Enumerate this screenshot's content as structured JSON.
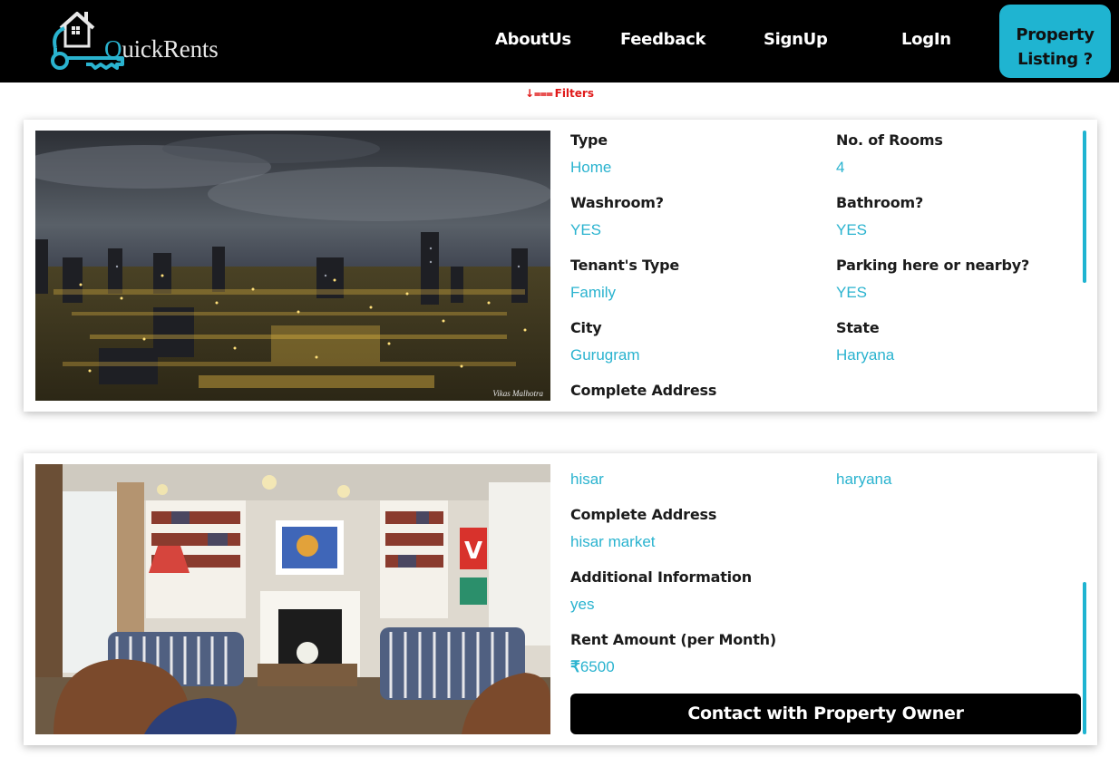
{
  "brand": {
    "name_prefix": "Q",
    "name_rest": "uickRents",
    "accent": "#1fb4d1"
  },
  "nav": {
    "about": "AboutUs",
    "feedback": "Feedback",
    "signup": "SignUp",
    "login": "LogIn",
    "cta_line1": "Property",
    "cta_line2": "Listing ?"
  },
  "filters": {
    "icon": "sort-filter-icon",
    "glyph": "↓⩶",
    "label": "Filters"
  },
  "listings": [
    {
      "image": "city-night-skyline",
      "image_caption": "Vikas Malhotra",
      "type_label": "Type",
      "type_value": "Home",
      "rooms_label": "No. of Rooms",
      "rooms_value": "4",
      "washroom_label": "Washroom?",
      "washroom_value": "YES",
      "bathroom_label": "Bathroom?",
      "bathroom_value": "YES",
      "tenant_label": "Tenant's Type",
      "tenant_value": "Family",
      "parking_label": "Parking here or nearby?",
      "parking_value": "YES",
      "city_label": "City",
      "city_value": "Gurugram",
      "state_label": "State",
      "state_value": "Haryana",
      "address_label": "Complete Address"
    },
    {
      "image": "living-room-interior",
      "city_value": "hisar",
      "state_value": "haryana",
      "address_label": "Complete Address",
      "address_value": "hisar market",
      "info_label": "Additional Information",
      "info_value": "yes",
      "rent_label": "Rent Amount (per Month)",
      "rent_currency": "₹",
      "rent_value": "6500",
      "contact_label": "Contact with Property Owner"
    }
  ]
}
